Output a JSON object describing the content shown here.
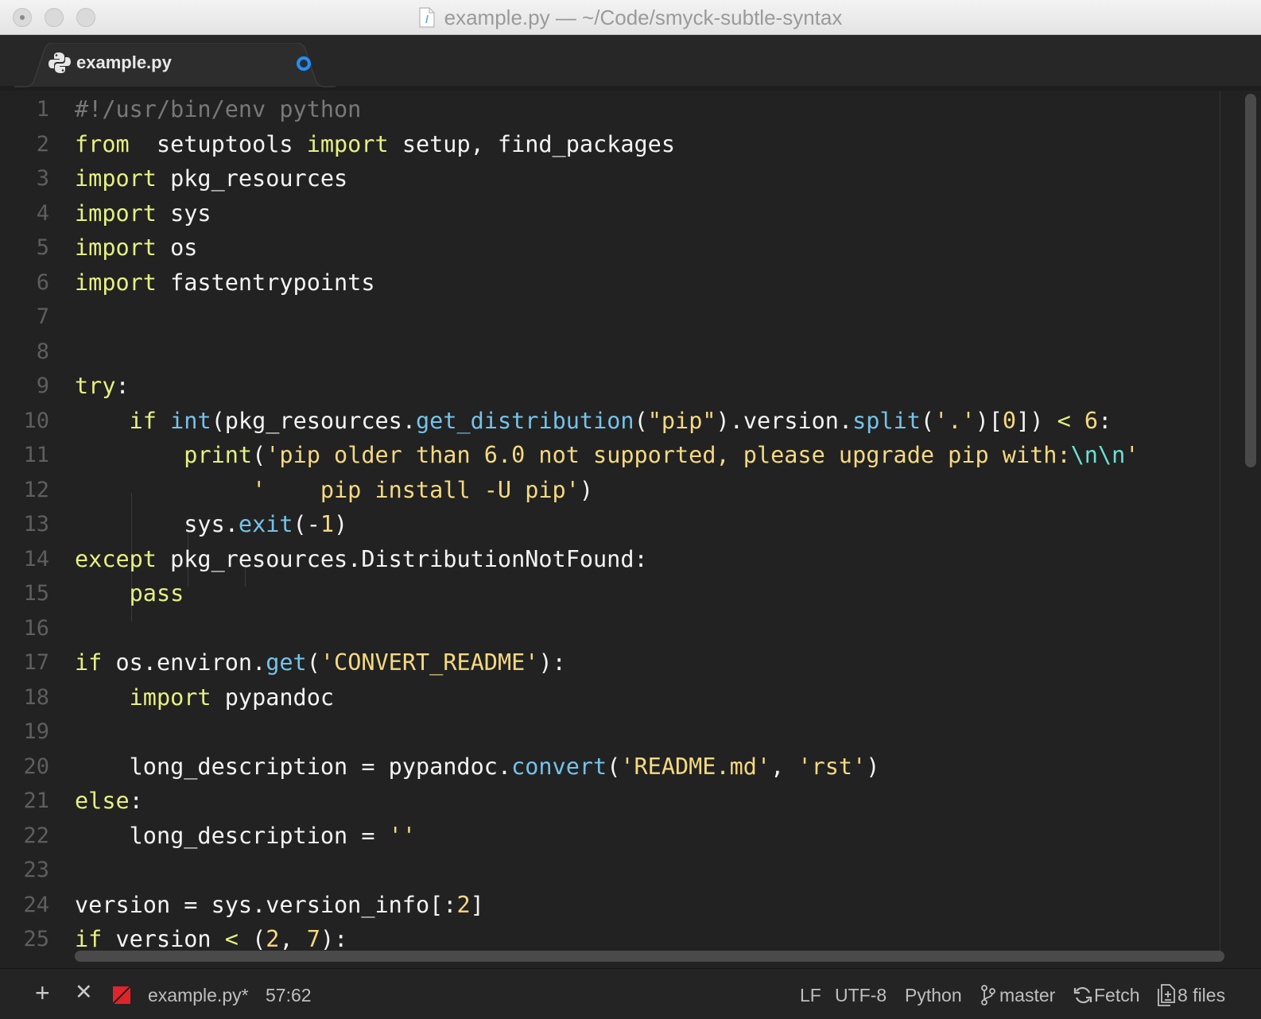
{
  "window": {
    "title": "example.py — ~/Code/smyck-subtle-syntax"
  },
  "tabs": [
    {
      "label": "example.py",
      "modified": true
    }
  ],
  "editor": {
    "line_numbers": [
      "1",
      "2",
      "3",
      "4",
      "5",
      "6",
      "7",
      "8",
      "9",
      "10",
      "11",
      "12",
      "13",
      "14",
      "15",
      "16",
      "17",
      "18",
      "19",
      "20",
      "21",
      "22",
      "23",
      "24",
      "25"
    ],
    "lines": [
      [
        [
          "cmt",
          "#!/usr/bin/env python"
        ]
      ],
      [
        [
          "kw",
          "from"
        ],
        [
          "",
          "  setuptools "
        ],
        [
          "kw",
          "import"
        ],
        [
          "",
          " setup, find_packages"
        ]
      ],
      [
        [
          "kw",
          "import"
        ],
        [
          "",
          " pkg_resources"
        ]
      ],
      [
        [
          "kw",
          "import"
        ],
        [
          "",
          " sys"
        ]
      ],
      [
        [
          "kw",
          "import"
        ],
        [
          "",
          " os"
        ]
      ],
      [
        [
          "kw",
          "import"
        ],
        [
          "",
          " fastentrypoints"
        ]
      ],
      [],
      [],
      [
        [
          "kw",
          "try"
        ],
        [
          "",
          ":"
        ]
      ],
      [
        [
          "",
          "    "
        ],
        [
          "kw",
          "if"
        ],
        [
          "",
          " "
        ],
        [
          "fn",
          "int"
        ],
        [
          "",
          "(pkg_resources."
        ],
        [
          "fn",
          "get_distribution"
        ],
        [
          "",
          "("
        ],
        [
          "str",
          "\"pip\""
        ],
        [
          "",
          ").version."
        ],
        [
          "fn",
          "split"
        ],
        [
          "",
          "("
        ],
        [
          "str",
          "'.'"
        ],
        [
          "",
          ")["
        ],
        [
          "num",
          "0"
        ],
        [
          "",
          "]) "
        ],
        [
          "op",
          "<"
        ],
        [
          "",
          " "
        ],
        [
          "num",
          "6"
        ],
        [
          "",
          ":"
        ]
      ],
      [
        [
          "",
          "        "
        ],
        [
          "kw",
          "print"
        ],
        [
          "",
          "("
        ],
        [
          "str",
          "'pip older than 6.0 not supported, please upgrade pip with:"
        ],
        [
          "esc",
          "\\n\\n"
        ],
        [
          "str",
          "'"
        ]
      ],
      [
        [
          "",
          "             "
        ],
        [
          "str",
          "'    pip install -U pip'"
        ],
        [
          "",
          ")"
        ]
      ],
      [
        [
          "",
          "        sys."
        ],
        [
          "fn",
          "exit"
        ],
        [
          "",
          "(-"
        ],
        [
          "num",
          "1"
        ],
        [
          "",
          ")"
        ]
      ],
      [
        [
          "kw",
          "except"
        ],
        [
          "",
          " pkg_resources.DistributionNotFound:"
        ]
      ],
      [
        [
          "",
          "    "
        ],
        [
          "kw",
          "pass"
        ]
      ],
      [],
      [
        [
          "kw",
          "if"
        ],
        [
          "",
          " os.environ."
        ],
        [
          "fn",
          "get"
        ],
        [
          "",
          "("
        ],
        [
          "str",
          "'CONVERT_README'"
        ],
        [
          "",
          "):"
        ]
      ],
      [
        [
          "",
          "    "
        ],
        [
          "kw",
          "import"
        ],
        [
          "",
          " pypandoc"
        ]
      ],
      [],
      [
        [
          "",
          "    long_description = pypandoc."
        ],
        [
          "fn",
          "convert"
        ],
        [
          "",
          "("
        ],
        [
          "str",
          "'README.md'"
        ],
        [
          "",
          ", "
        ],
        [
          "str",
          "'rst'"
        ],
        [
          "",
          ")"
        ]
      ],
      [
        [
          "kw",
          "else"
        ],
        [
          "",
          ":"
        ]
      ],
      [
        [
          "",
          "    long_description = "
        ],
        [
          "str",
          "''"
        ]
      ],
      [],
      [
        [
          "",
          "version = sys.version_info[:"
        ],
        [
          "num",
          "2"
        ],
        [
          "",
          "]"
        ]
      ],
      [
        [
          "kw",
          "if"
        ],
        [
          "",
          " version "
        ],
        [
          "op",
          "<"
        ],
        [
          "",
          " ("
        ],
        [
          "num",
          "2"
        ],
        [
          "",
          ", "
        ],
        [
          "num",
          "7"
        ],
        [
          "",
          "):"
        ]
      ]
    ]
  },
  "status_bar": {
    "add_label": "+",
    "close_label": "✕",
    "file": "example.py*",
    "cursor": "57:62",
    "line_ending": "LF",
    "encoding": "UTF-8",
    "grammar": "Python",
    "branch": "master",
    "fetch": "Fetch",
    "files": "8 files"
  },
  "colors": {
    "keyword": "#e6f082",
    "string": "#f5d982",
    "function": "#74c3ea",
    "comment": "#787878",
    "escape": "#6ee0d2",
    "modified_dot": "#1e90ff",
    "error_badge": "#e0242b"
  }
}
